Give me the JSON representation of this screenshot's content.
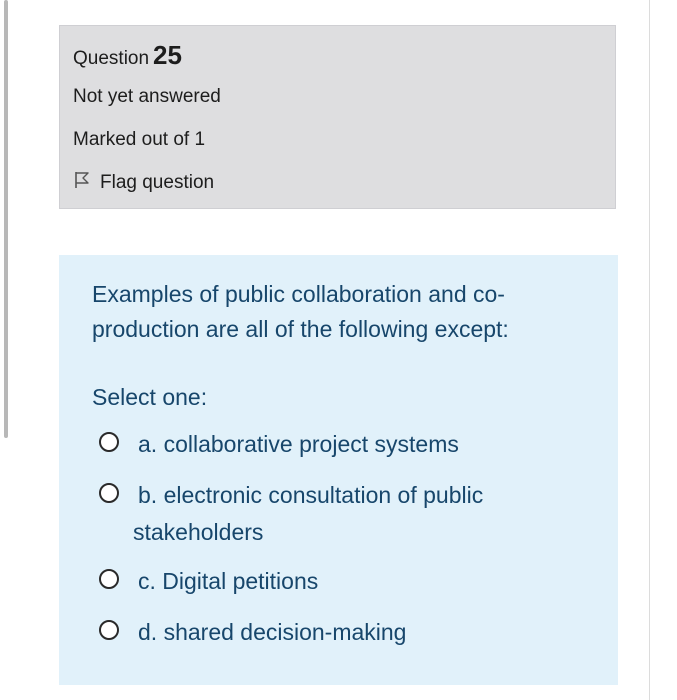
{
  "info": {
    "question_prefix": "Question",
    "question_number": "25",
    "state": "Not yet answered",
    "grade": "Marked out of 1",
    "flag_label": "Flag question"
  },
  "question": {
    "text": "Examples of public collaboration and co-production are all of the following except:",
    "prompt": "Select one:",
    "options": [
      {
        "label": "a. collaborative project systems"
      },
      {
        "label": "b. electronic consultation of public",
        "label_cont": "stakeholders"
      },
      {
        "label": "c. Digital petitions"
      },
      {
        "label": "d. shared decision-making"
      }
    ]
  },
  "colors": {
    "info_bg": "#dedee0",
    "content_bg": "#e1f1fa",
    "text_blue": "#17466b"
  },
  "icons": {
    "flag": "flag-outline-icon",
    "radio": "radio-empty-icon"
  }
}
